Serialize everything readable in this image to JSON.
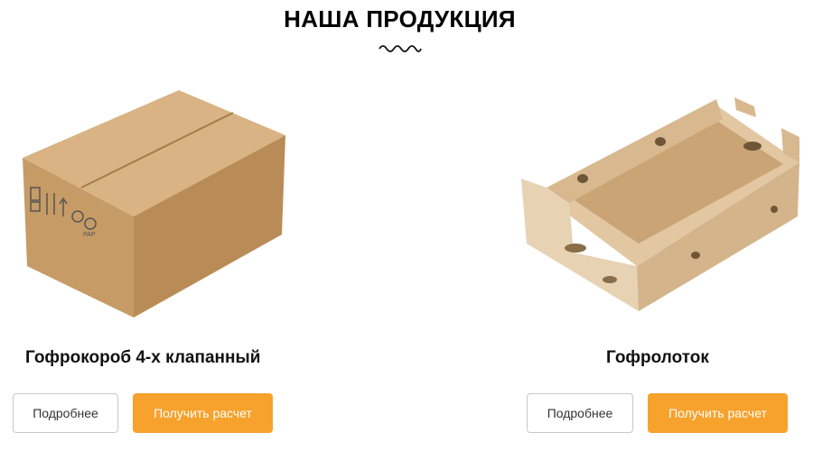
{
  "section": {
    "title": "НАША ПРОДУКЦИЯ"
  },
  "products": [
    {
      "name": "Гофрокороб 4-х клапанный",
      "details_label": "Подробнее",
      "quote_label": "Получить расчет",
      "image_icon": "cardboard-box-icon"
    },
    {
      "name": "Гофролоток",
      "details_label": "Подробнее",
      "quote_label": "Получить расчет",
      "image_icon": "cardboard-tray-icon"
    }
  ],
  "colors": {
    "accent": "#f7a22c",
    "cardboard": "#c9a06d",
    "text": "#111111"
  }
}
